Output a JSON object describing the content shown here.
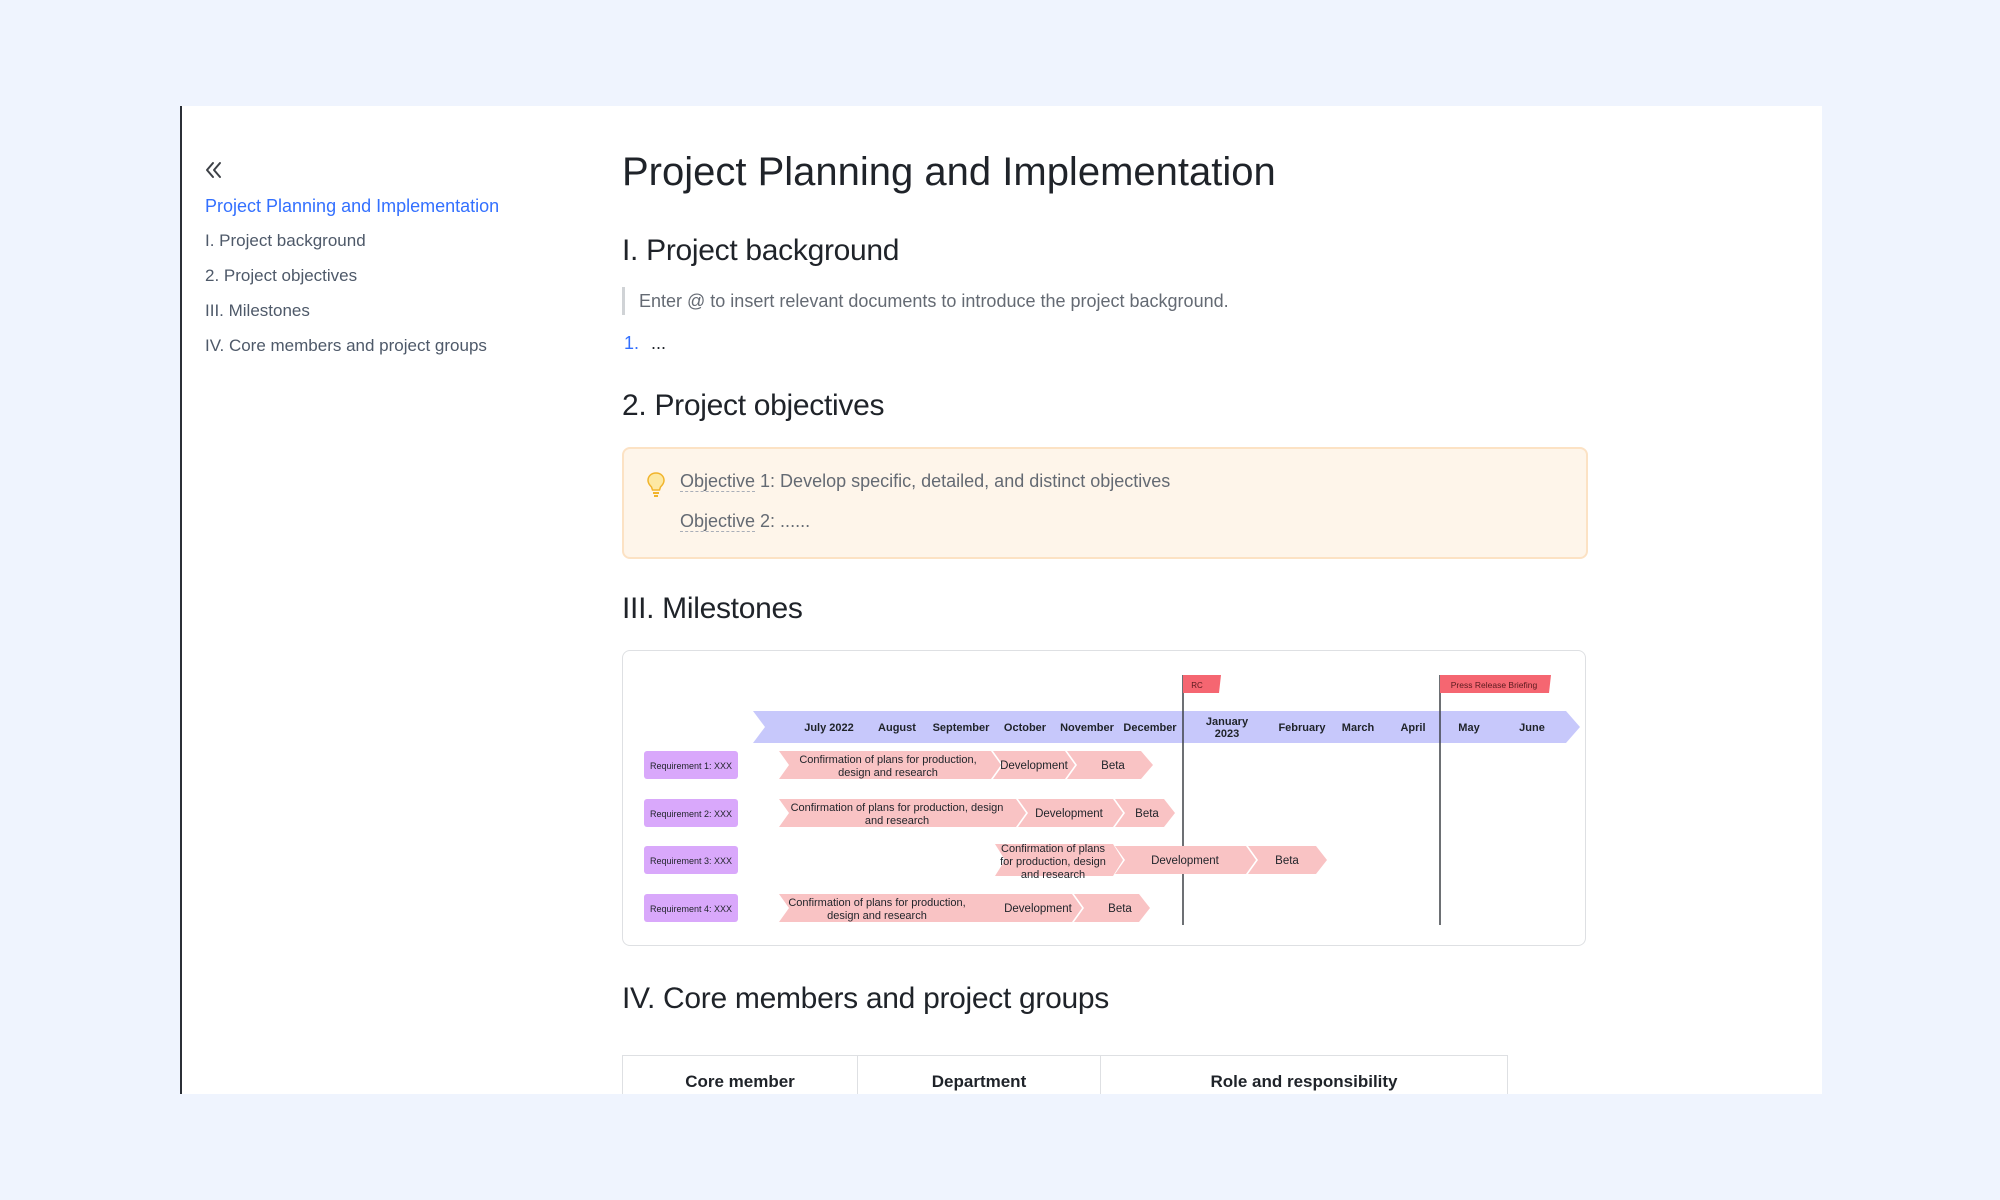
{
  "outline": {
    "items": [
      {
        "label": "Project Planning and Implementation",
        "active": true
      },
      {
        "label": "I. Project background",
        "active": false
      },
      {
        "label": "2. Project objectives",
        "active": false
      },
      {
        "label": "III. Milestones",
        "active": false
      },
      {
        "label": "IV. Core members and project groups",
        "active": false
      }
    ]
  },
  "doc": {
    "title": "Project Planning and Implementation",
    "background": {
      "heading": "I. Project background",
      "quote": "Enter @ to insert relevant documents to introduce the project background.",
      "list": [
        {
          "num": "1.",
          "text": "..."
        }
      ]
    },
    "objectives": {
      "heading": "2. Project objectives",
      "lines": [
        {
          "keyword": "Objective",
          "rest": " 1: Develop specific, detailed, and distinct objectives"
        },
        {
          "keyword": "Objective",
          "rest": " 2: ......"
        }
      ]
    },
    "milestones": {
      "heading": "III. Milestones",
      "months": [
        "July 2022",
        "August",
        "September",
        "October",
        "November",
        "December",
        "January 2023",
        "February",
        "March",
        "April",
        "May",
        "June"
      ],
      "flags": [
        "RC",
        "Press Release Briefing"
      ],
      "requirements": [
        {
          "label": "Requirement 1: XXX",
          "phases": [
            "Confirmation of plans for production, design and research",
            "Development",
            "Beta"
          ]
        },
        {
          "label": "Requirement 2: XXX",
          "phases": [
            "Confirmation of plans for production, design and research",
            "Development",
            "Beta"
          ]
        },
        {
          "label": "Requirement 3: XXX",
          "phases": [
            "Confirmation of plans for production, design and research",
            "Development",
            "Beta"
          ]
        },
        {
          "label": "Requirement 4: XXX",
          "phases": [
            "Confirmation of plans for production, design and research",
            "Development",
            "Beta"
          ]
        }
      ]
    },
    "members": {
      "heading": "IV. Core members and project groups",
      "columns": [
        "Core member",
        "Department",
        "Role and responsibility"
      ]
    }
  },
  "colors": {
    "accent": "#3370ff",
    "callout_bg": "#fef5ea",
    "timeline": "#c7c8fb",
    "phase": "#f9c3c4",
    "requirement": "#d9a8fb",
    "flag": "#f56671"
  },
  "icons": {
    "collapse": "double-chevron-left-icon",
    "callout": "lightbulb-icon"
  }
}
